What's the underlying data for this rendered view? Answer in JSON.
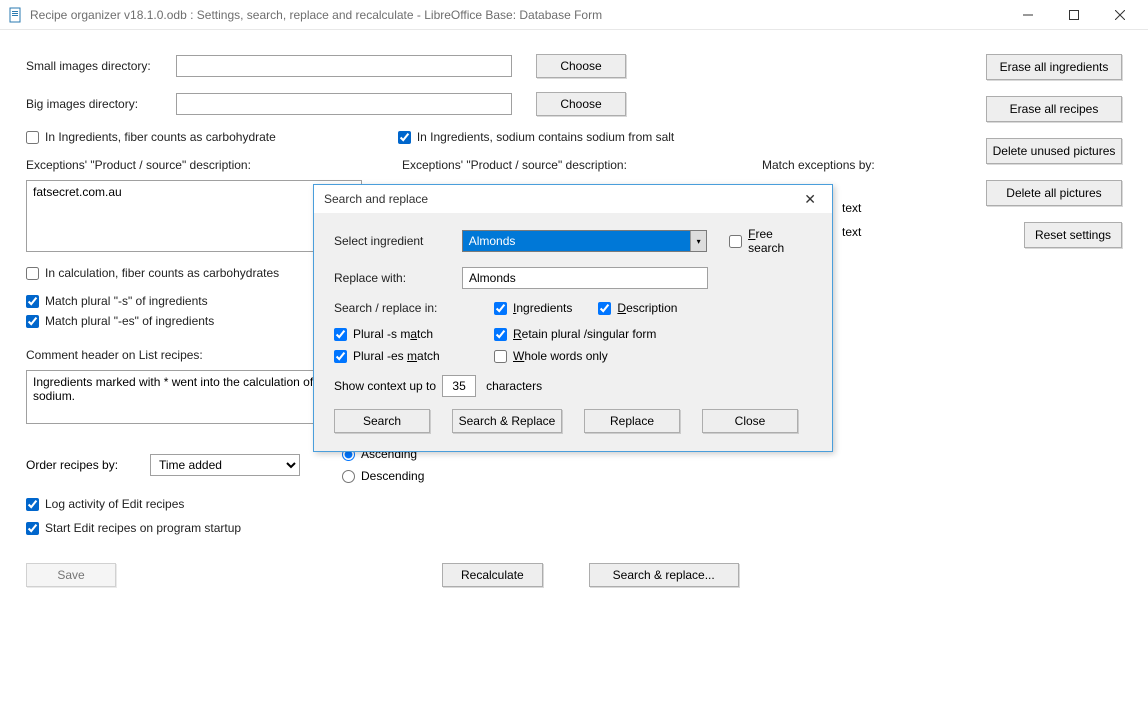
{
  "window": {
    "title": "Recipe organizer v18.1.0.odb : Settings, search, replace and recalculate - LibreOffice Base: Database Form"
  },
  "labels": {
    "small_images": "Small images directory:",
    "big_images": "Big images directory:",
    "choose": "Choose",
    "fiber_carb_ing": "In Ingredients, fiber counts as carbohydrate",
    "sodium_salt": "In Ingredients, sodium contains sodium from salt",
    "exceptions_left": "Exceptions' \"Product / source\" description:",
    "exceptions_right": "Exceptions' \"Product / source\" description:",
    "match_exceptions": "Match exceptions by:",
    "match_text1": "text",
    "match_text2": "text",
    "fiber_carb_calc": "In calculation, fiber counts as carbohydrates",
    "match_plural_s": "Match plural \"-s\" of ingredients",
    "match_plural_es": "Match plural \"-es\" of ingredients",
    "comment_header": "Comment header on List recipes:",
    "order_by": "Order recipes by:",
    "ascending": "Ascending",
    "descending": "Descending",
    "log_activity": "Log activity of Edit recipes",
    "start_edit": "Start Edit recipes on program startup",
    "save": "Save",
    "recalculate": "Recalculate",
    "search_replace": "Search & replace..."
  },
  "values": {
    "small_images": "",
    "big_images": "",
    "exceptions_text": "fatsecret.com.au",
    "comment_text": "Ingredients marked with * went into the calculation of sodium. 1 g salt contains 0.4 g sodium.",
    "order_selected": "Time added"
  },
  "side": {
    "erase_ing": "Erase all ingredients",
    "erase_rec": "Erase all recipes",
    "del_unused": "Delete unused pictures",
    "del_all": "Delete all pictures",
    "reset": "Reset settings"
  },
  "dialog": {
    "title": "Search and replace",
    "select_ing": "Select ingredient",
    "select_value": "Almonds",
    "free_search": "Free search",
    "replace_with": "Replace with:",
    "replace_value": "Almonds",
    "search_in": "Search / replace in:",
    "ingredients": "Ingredients",
    "description": "Description",
    "plural_s": "Plural -s match",
    "plural_es": "Plural -es match",
    "retain": "Retain plural /singular form",
    "whole_words": "Whole words only",
    "show_context": "Show context up to",
    "context_val": "35",
    "characters": "characters",
    "search": "Search",
    "search_replace": "Search & Replace",
    "replace": "Replace",
    "close": "Close"
  }
}
